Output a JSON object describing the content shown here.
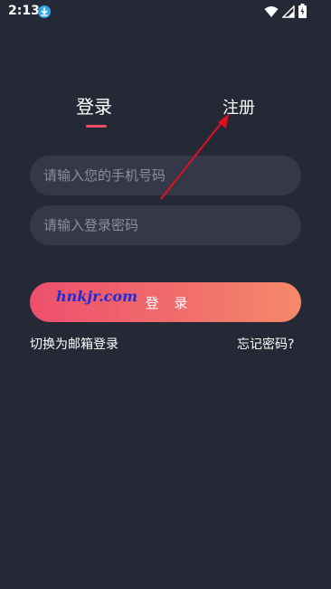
{
  "status_bar": {
    "time": "2:13",
    "icons": [
      "download-icon",
      "wifi-icon",
      "signal-icon",
      "battery-icon"
    ]
  },
  "tabs": {
    "login": "登录",
    "register": "注册",
    "active": "login"
  },
  "fields": {
    "phone_placeholder": "请输入您的手机号码",
    "password_placeholder": "请输入登录密码"
  },
  "login_button": {
    "label": "登 录"
  },
  "watermark": "hnkjr.com",
  "links": {
    "switch_email": "切换为邮箱登录",
    "forgot_password": "忘记密码?"
  },
  "colors": {
    "background": "#252936",
    "field_bg": "#343848",
    "accent": "#ef4e67",
    "button_gradient_start": "#ee4f6c",
    "button_gradient_end": "#f6896a",
    "annotation_arrow": "#e01020",
    "watermark": "#1e2bd6"
  }
}
